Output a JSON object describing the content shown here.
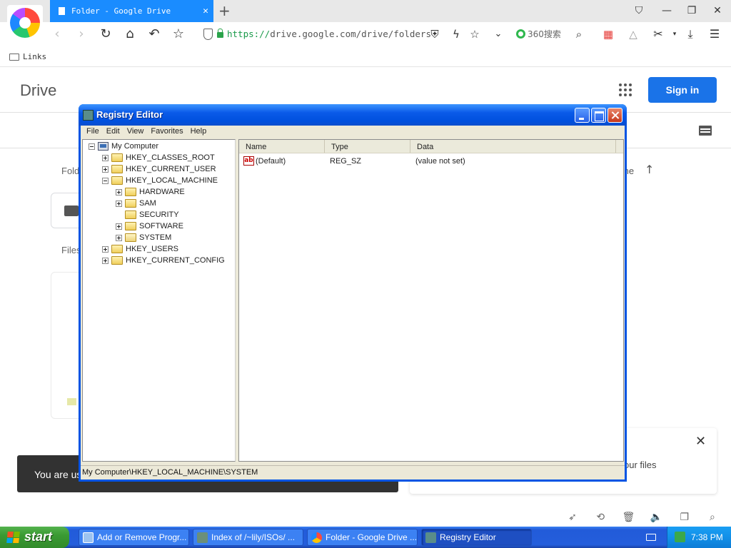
{
  "browser": {
    "tab_title": "Folder - Google Drive",
    "new_tab": "+",
    "address": {
      "scheme": "https://",
      "rest": "drive.google.com/drive/folders"
    },
    "search_engine": "360搜索",
    "bookmarks": [
      "Links"
    ]
  },
  "drive": {
    "title": "Drive",
    "signin_label": "Sign in",
    "folders_label": "Fold",
    "files_label": "Files",
    "sort_label": "me",
    "snackbar_text": "You are us",
    "panel_text": "our files",
    "close_glyph": "✕"
  },
  "regedit": {
    "title": "Registry Editor",
    "menu": [
      "File",
      "Edit",
      "View",
      "Favorites",
      "Help"
    ],
    "tree": {
      "root": "My Computer",
      "hklm_children": [
        "HARDWARE",
        "SAM",
        "SECURITY",
        "SOFTWARE",
        "SYSTEM"
      ],
      "hives": [
        "HKEY_CLASSES_ROOT",
        "HKEY_CURRENT_USER",
        "HKEY_LOCAL_MACHINE",
        "HKEY_USERS",
        "HKEY_CURRENT_CONFIG"
      ]
    },
    "columns": [
      "Name",
      "Type",
      "Data"
    ],
    "values": [
      {
        "name": "(Default)",
        "type": "REG_SZ",
        "data": "(value not set)",
        "icon": "ab"
      }
    ],
    "status": "My Computer\\HKEY_LOCAL_MACHINE\\SYSTEM"
  },
  "taskbar": {
    "start": "start",
    "tasks": [
      "Add or Remove Progr...",
      "Index of /~lily/ISOs/ ...",
      "Folder - Google Drive ...",
      "Registry Editor"
    ],
    "clock": "7:38 PM"
  },
  "colors": {
    "accent": "#1a73e8",
    "tab_active": "#1a8cff",
    "xp_blue": "#0054e3",
    "start_green": "#3a9a33"
  }
}
